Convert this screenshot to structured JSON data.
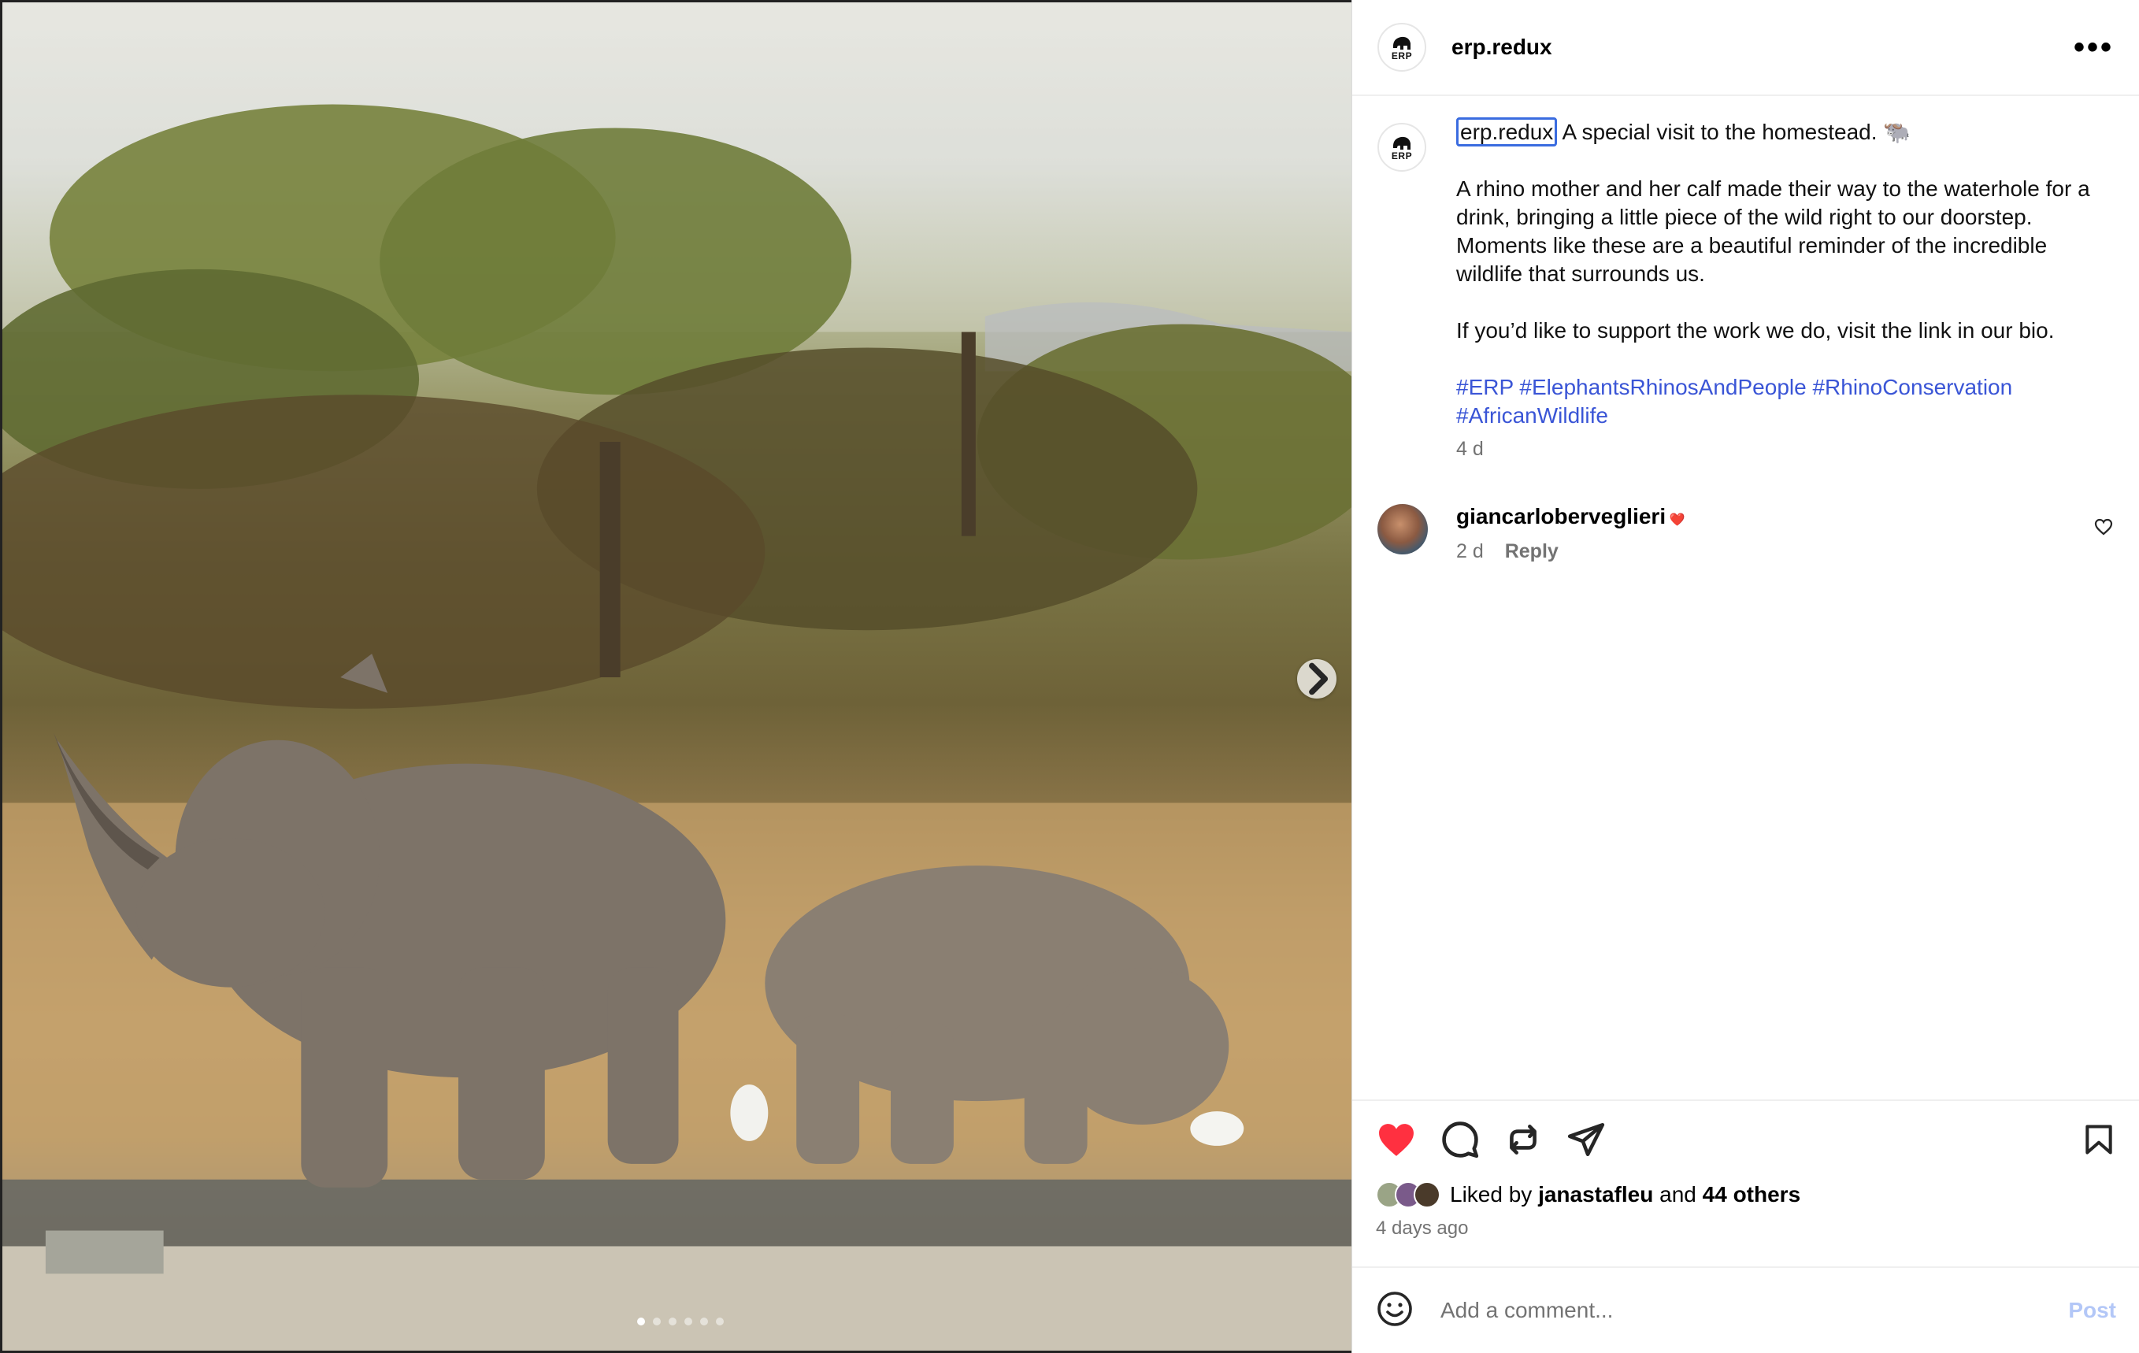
{
  "post": {
    "username": "erp.redux",
    "avatar_text": "ERP",
    "more_label": "•••",
    "caption": {
      "username": "erp.redux",
      "line1": "A special visit to the homestead. 🐃",
      "paragraph2": "A rhino mother and her calf made their way to the waterhole for a drink, bringing a little piece of the wild right to our doorstep. Moments like these are a beautiful reminder of the incredible wildlife that surrounds us.",
      "paragraph3": "If you’d like to support the work we do, visit the link in our bio.",
      "hashtags": "#ERP #ElephantsRhinosAndPeople #RhinoConservation #AfricanWildlife",
      "time": "4 d"
    },
    "comment": {
      "username": "giancarloberveglieri",
      "text": "❤️",
      "time": "2 d",
      "reply_label": "Reply"
    },
    "likes": {
      "prefix": "Liked by",
      "user": "janastafleu",
      "joiner": "and",
      "others": "44 others"
    },
    "posted": "4 days ago",
    "comment_input": {
      "placeholder": "Add a comment..."
    },
    "post_label": "Post",
    "carousel": {
      "count": 6,
      "active_index": 0
    }
  },
  "colors": {
    "like_red": "#ff3040",
    "link_blue": "#3a55d6",
    "muted": "#737373",
    "post_disabled": "#b3c7f7"
  },
  "icons": [
    "chevron-right-icon",
    "more-icon",
    "heart-icon",
    "comment-icon",
    "repost-icon",
    "share-icon",
    "bookmark-icon",
    "emoji-icon"
  ]
}
